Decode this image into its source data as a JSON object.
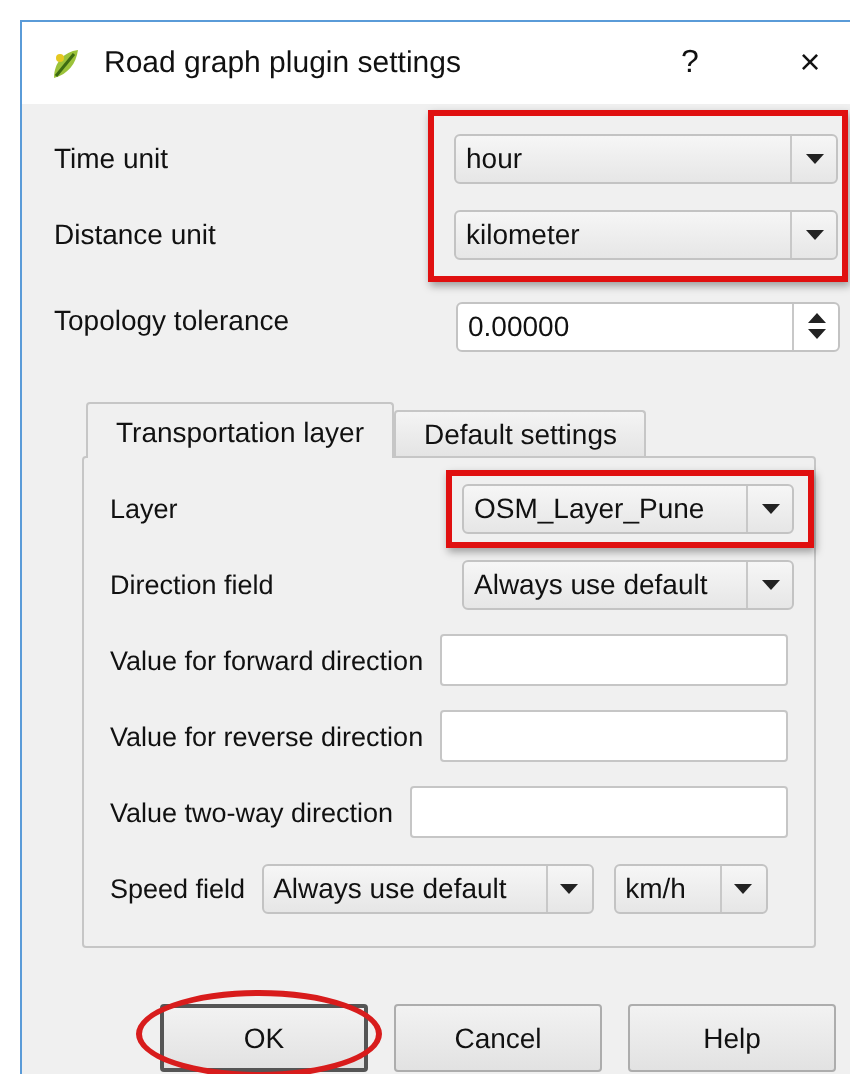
{
  "window": {
    "title": "Road graph plugin settings",
    "help": "?",
    "close": "×"
  },
  "fields": [
    {
      "label": "Time unit",
      "kind": "combo",
      "value": "hour",
      "highlighted": true
    },
    {
      "label": "Distance unit",
      "kind": "combo",
      "value": "kilometer",
      "highlighted": true
    },
    {
      "label": "Topology tolerance",
      "kind": "spin",
      "value": "0.00000"
    }
  ],
  "tabs": [
    {
      "label": "Transportation layer",
      "selected": true
    },
    {
      "label": "Default settings",
      "selected": false
    }
  ],
  "layer_fields": [
    {
      "label": "Layer",
      "kind": "combo",
      "value": "OSM_Layer_Pune",
      "highlighted": true
    },
    {
      "label": "Direction field",
      "kind": "combo",
      "value": "Always use default"
    },
    {
      "label": "Value for forward direction",
      "kind": "text"
    },
    {
      "label": "Value for reverse direction",
      "kind": "text"
    },
    {
      "label": "Value two-way direction",
      "kind": "text"
    },
    {
      "label": "Speed field",
      "kind": "combo_unit",
      "value": "Always use default",
      "unit": "km/h"
    }
  ],
  "buttons": [
    {
      "label": "OK",
      "highlighted": true,
      "default": true
    },
    {
      "label": "Cancel",
      "default": false
    },
    {
      "label": "Help",
      "default": false
    }
  ]
}
